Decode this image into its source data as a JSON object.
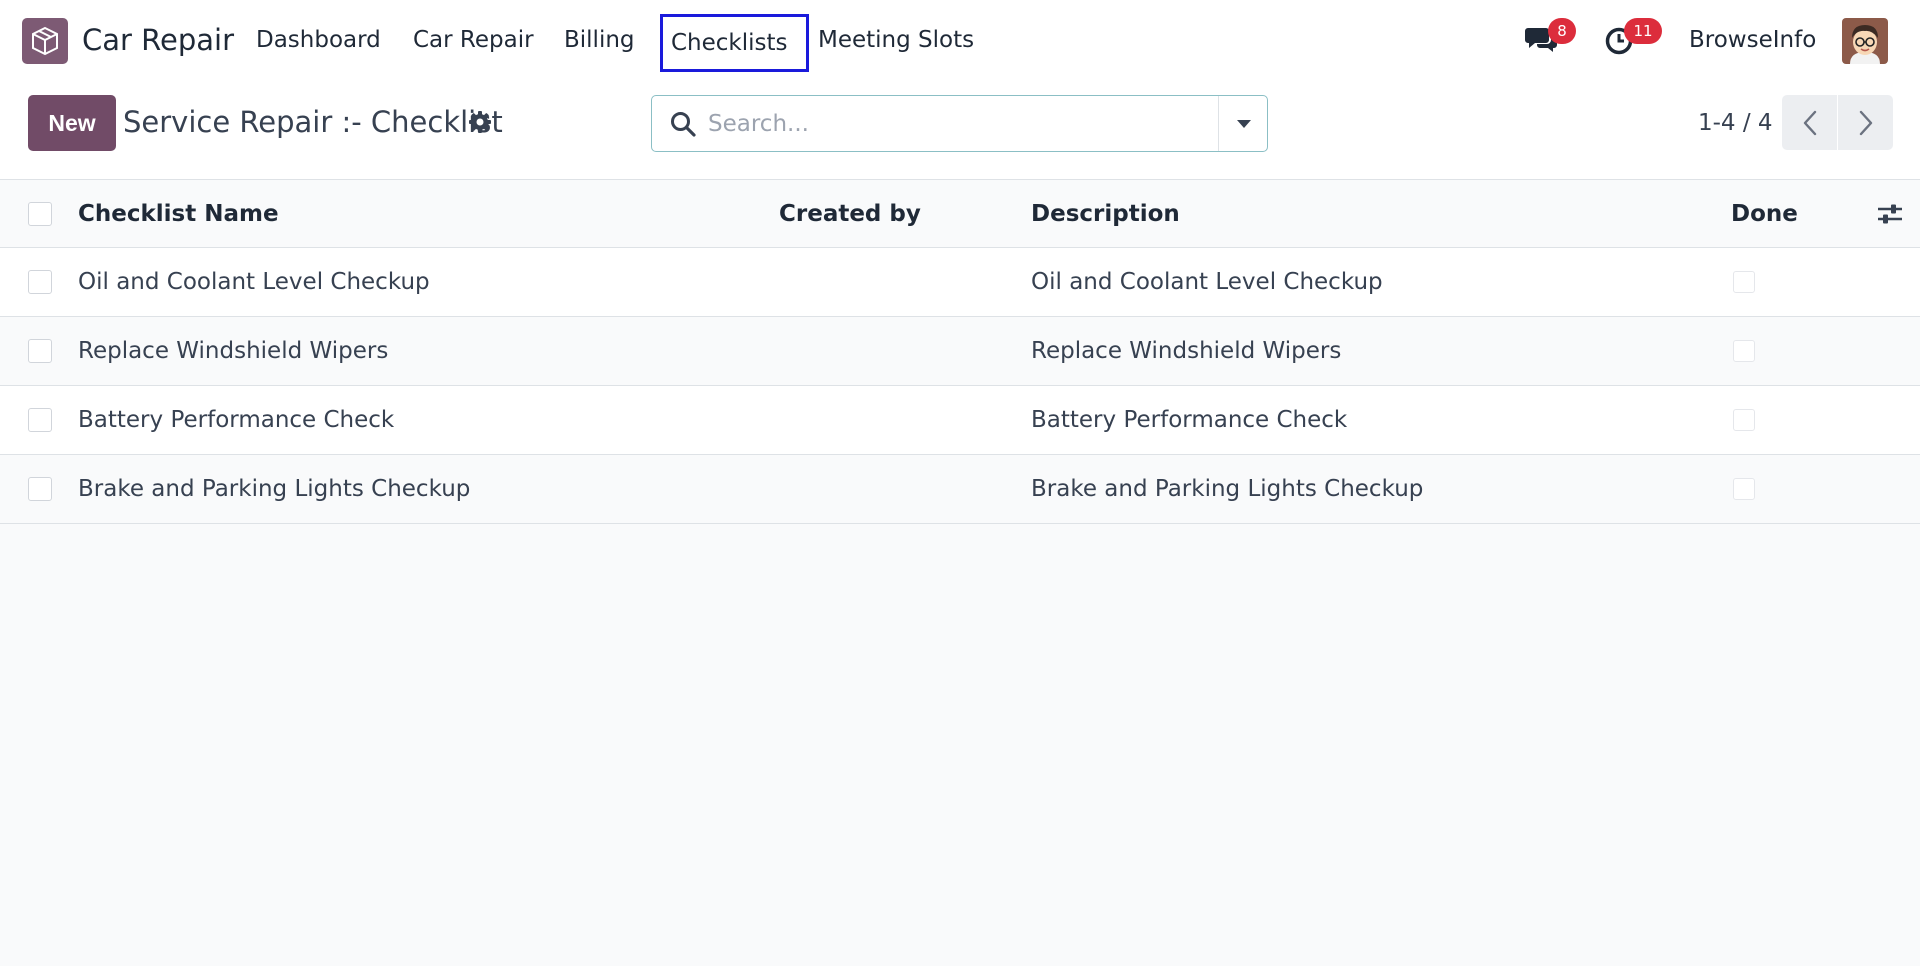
{
  "navbar": {
    "app_name": "Car Repair",
    "menu": [
      "Dashboard",
      "Car Repair",
      "Billing",
      "Checklists",
      "Meeting Slots"
    ],
    "active_menu": "Checklists",
    "messages_badge": "8",
    "activities_badge": "11",
    "user_name": "BrowseInfo"
  },
  "control": {
    "new_label": "New",
    "breadcrumb": "Service Repair :- Checklist",
    "search_placeholder": "Search...",
    "pager": "1-4 / 4"
  },
  "table": {
    "columns": [
      "Checklist Name",
      "Created by",
      "Description",
      "Done"
    ],
    "rows": [
      {
        "name": "Oil and Coolant Level Checkup",
        "created_by": "",
        "description": "Oil and Coolant Level Checkup",
        "done": false
      },
      {
        "name": "Replace Windshield Wipers",
        "created_by": "",
        "description": "Replace Windshield Wipers",
        "done": false
      },
      {
        "name": "Battery Performance Check",
        "created_by": "",
        "description": "Battery Performance Check",
        "done": false
      },
      {
        "name": "Brake and Parking Lights Checkup",
        "created_by": "",
        "description": "Brake and Parking Lights Checkup",
        "done": false
      }
    ]
  },
  "colors": {
    "brand": "#714b67",
    "badge": "#dc2d3c",
    "active_outline": "#1a1adb"
  }
}
